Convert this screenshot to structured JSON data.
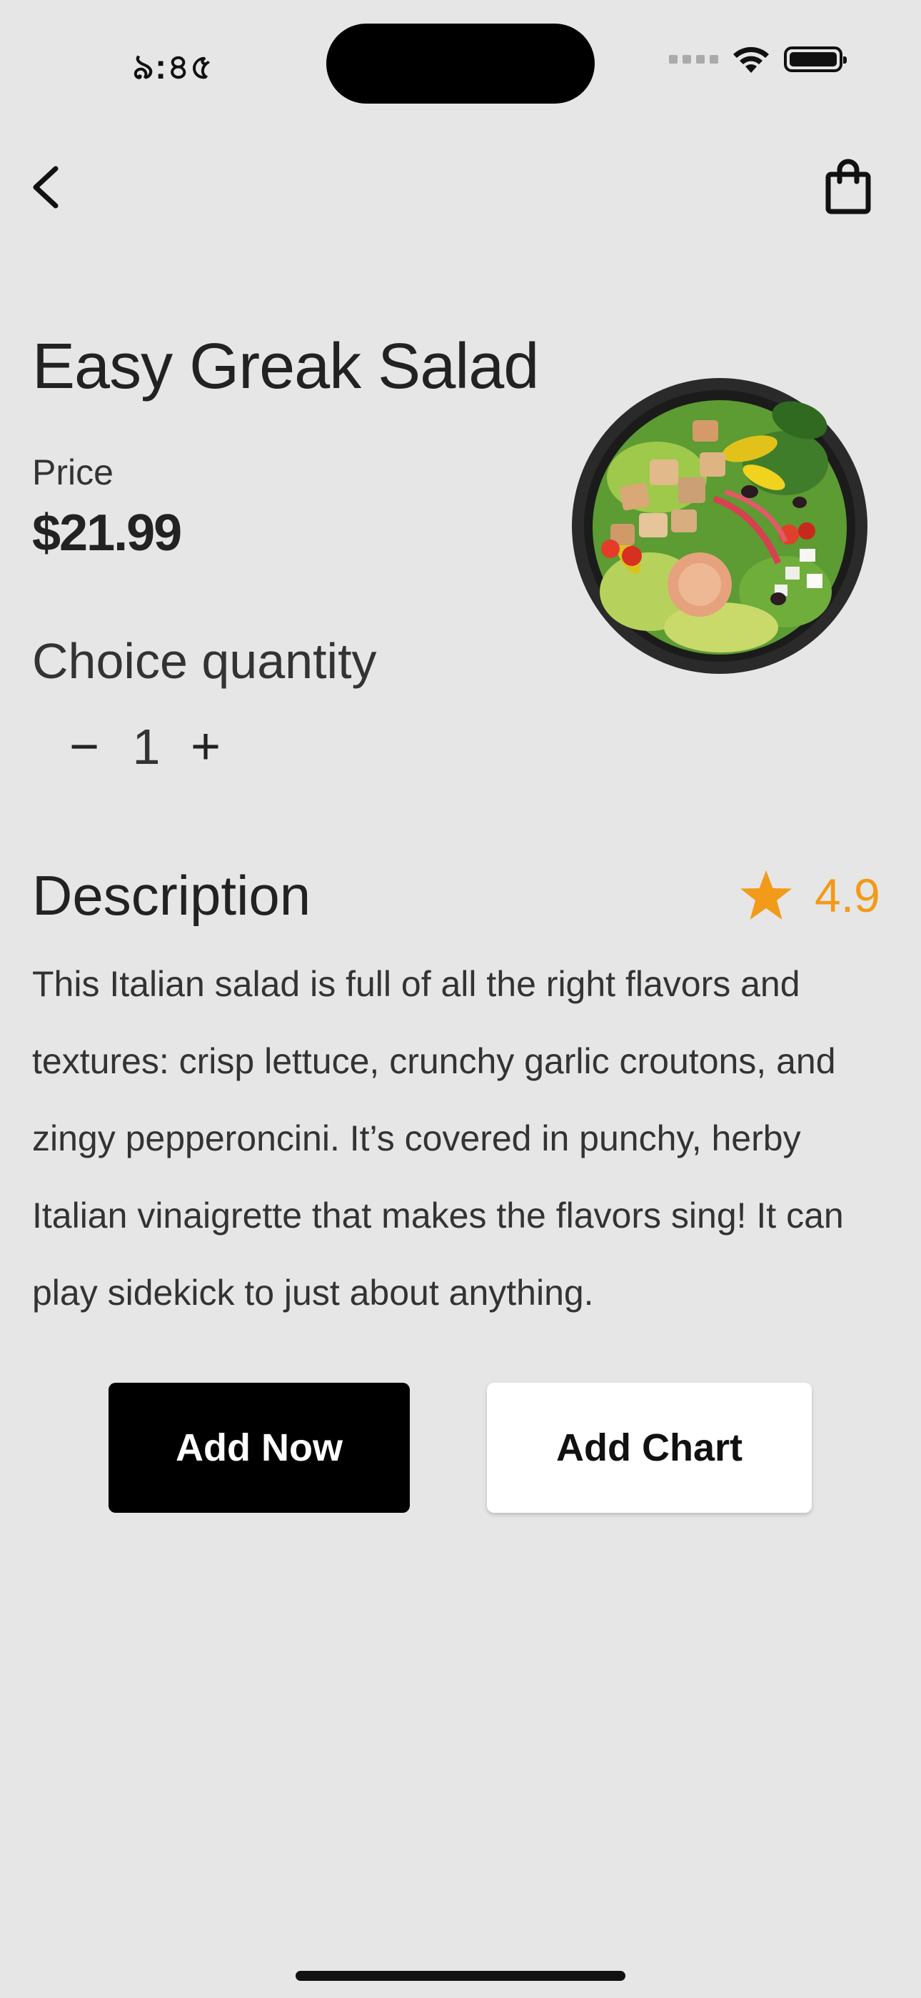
{
  "status_bar": {
    "time": "৯:৪৫"
  },
  "product": {
    "title": "Easy Greak Salad",
    "price_label": "Price",
    "price": "$21.99",
    "quantity_label": "Choice quantity",
    "quantity_minus": "−",
    "quantity": "1",
    "quantity_plus": "+"
  },
  "description": {
    "heading": "Description",
    "rating": "4.9",
    "body": "This Italian salad is full of all the right flavors and textures: crisp lettuce, crunchy garlic croutons, and zingy pepperoncini. It’s covered in punchy, herby Italian vinaigrette that makes the flavors sing! It can play sidekick to just about anything."
  },
  "actions": {
    "add_now": "Add Now",
    "add_chart": "Add Chart"
  },
  "icons": {
    "back": "chevron-left-icon",
    "bag": "shopping-bag-icon",
    "star": "star-icon"
  },
  "colors": {
    "background": "#e6e6e6",
    "accent": "#f29a1a",
    "primary_button": "#000000"
  }
}
